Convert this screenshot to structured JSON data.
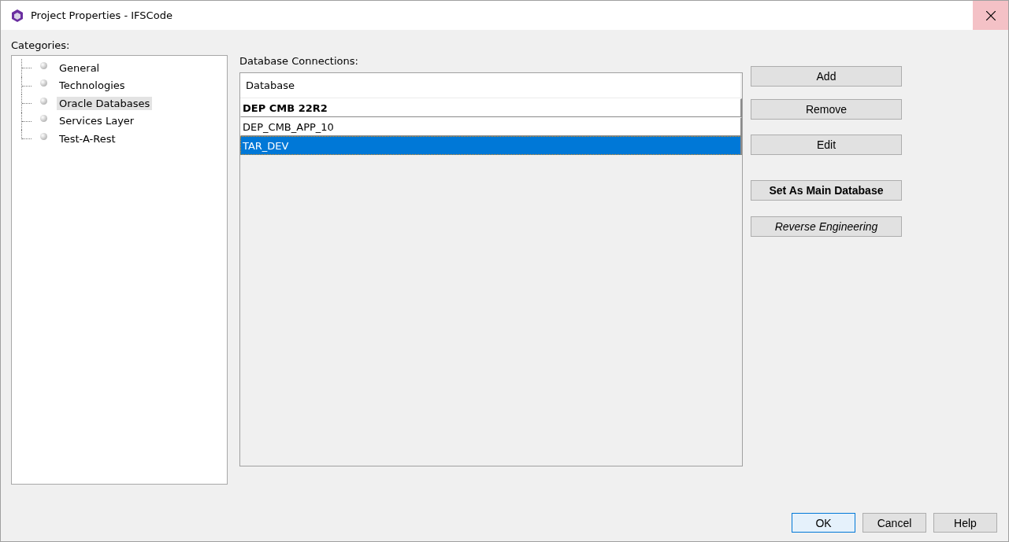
{
  "window": {
    "title": "Project Properties - IFSCode"
  },
  "categories": {
    "label": "Categories:",
    "items": [
      {
        "label": "General",
        "selected": false
      },
      {
        "label": "Technologies",
        "selected": false
      },
      {
        "label": "Oracle Databases",
        "selected": true
      },
      {
        "label": "Services Layer",
        "selected": false
      },
      {
        "label": "Test-A-Rest",
        "selected": false
      }
    ]
  },
  "connections": {
    "label": "Database Connections:",
    "column": "Database",
    "rows": [
      {
        "name": "DEP CMB 22R2",
        "main": true,
        "selected": false
      },
      {
        "name": "DEP_CMB_APP_10",
        "main": false,
        "selected": false
      },
      {
        "name": "TAR_DEV",
        "main": false,
        "selected": true
      }
    ]
  },
  "side_buttons": [
    {
      "label": "Add",
      "kind": "plain"
    },
    {
      "label": "Remove",
      "kind": "plain"
    },
    {
      "label": "Edit",
      "kind": "plain"
    },
    {
      "label": "Set As Main Database",
      "kind": "bold"
    },
    {
      "label": "Reverse Engineering",
      "kind": "italic"
    }
  ],
  "footer_buttons": [
    {
      "label": "OK",
      "default": true
    },
    {
      "label": "Cancel",
      "default": false
    },
    {
      "label": "Help",
      "default": false
    }
  ]
}
